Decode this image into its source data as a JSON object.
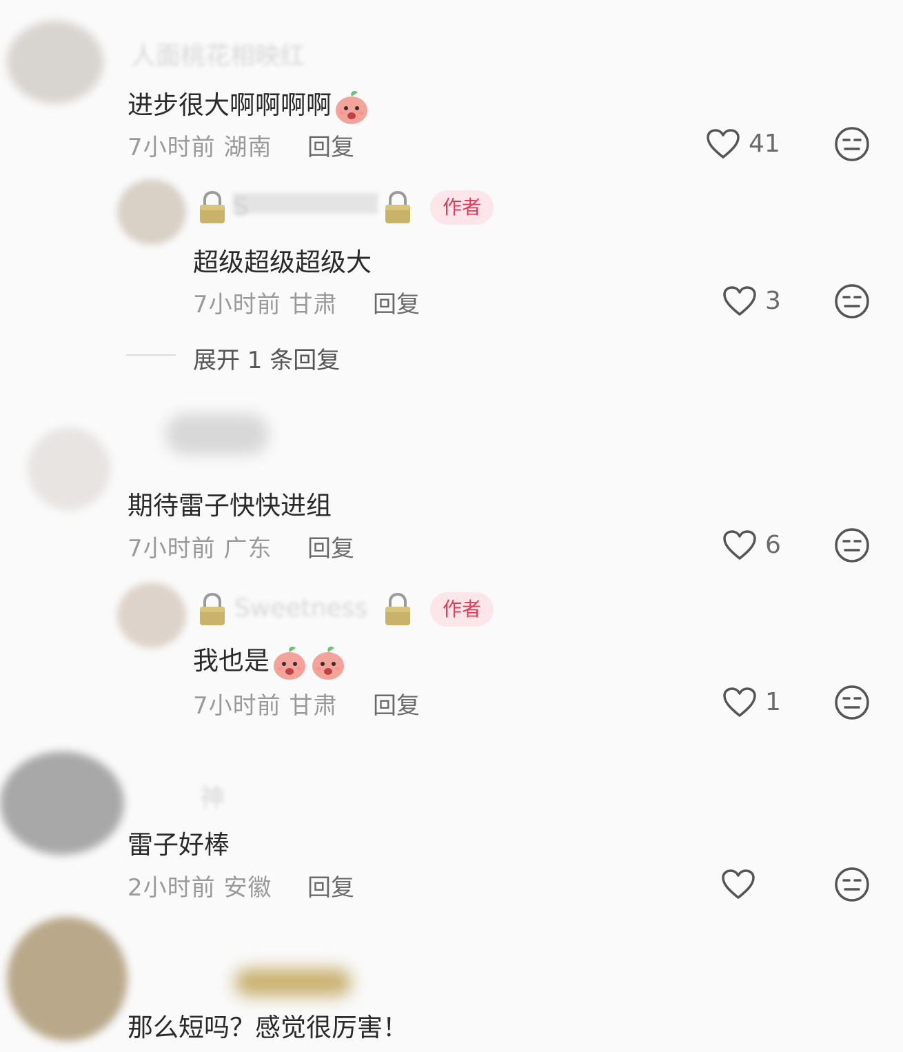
{
  "comments": [
    {
      "name_blurred": "人面桃花相映红",
      "text": "进步很大啊啊啊啊",
      "time": "7小时前",
      "region": "湖南",
      "reply_label": "回复",
      "likes": "41",
      "replies": [
        {
          "name_blurred": "S",
          "author_badge": "作者",
          "text": "超级超级超级大",
          "time": "7小时前",
          "region": "甘肃",
          "reply_label": "回复",
          "likes": "3"
        }
      ],
      "expand_label": "展开 1 条回复"
    },
    {
      "name_blurred": "",
      "text": "期待雷子快快进组",
      "time": "7小时前",
      "region": "广东",
      "reply_label": "回复",
      "likes": "6",
      "replies": [
        {
          "name_blurred": "Sweetness",
          "author_badge": "作者",
          "text": "我也是",
          "time": "7小时前",
          "region": "甘肃",
          "reply_label": "回复",
          "likes": "1"
        }
      ]
    },
    {
      "name_blurred": "神",
      "text": "雷子好棒",
      "time": "2小时前",
      "region": "安徽",
      "reply_label": "回复",
      "likes": ""
    },
    {
      "name_blurred": "",
      "text": "那么短吗？感觉很厉害！"
    }
  ],
  "icons": {
    "like": "heart-outline-icon",
    "dislike": "neutral-face-icon",
    "lock": "lock-emoji",
    "emoji": "peach-face-emoji"
  },
  "colors": {
    "badge_bg": "#fde6ea",
    "badge_text": "#e23b5a",
    "meta": "#9a9a9a",
    "text": "#2a2a2a"
  }
}
